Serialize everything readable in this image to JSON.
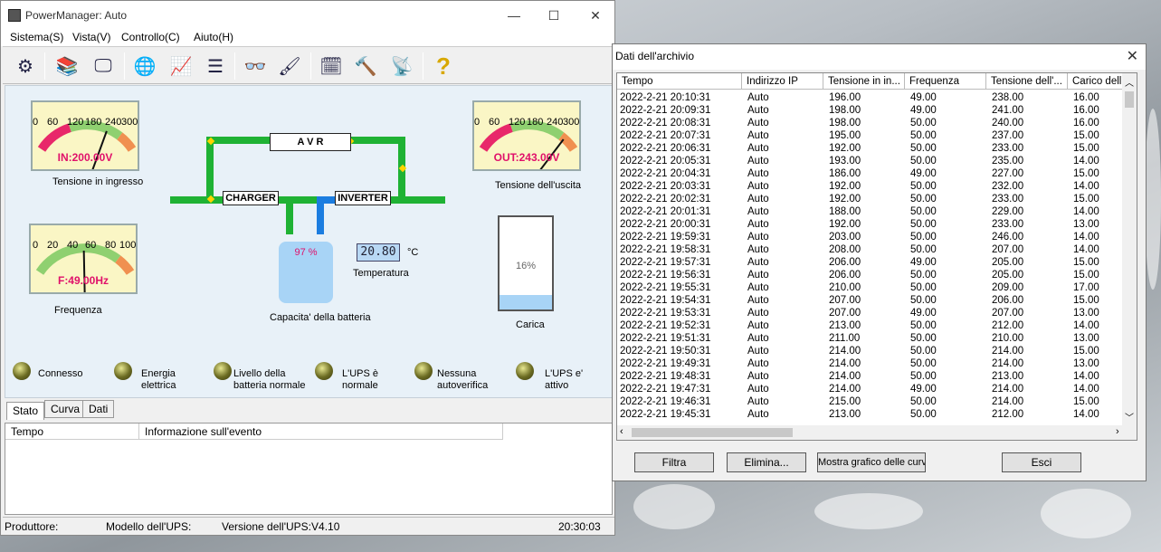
{
  "window": {
    "title": "PowerManager: Auto",
    "minimize": "—",
    "maximize": "☐",
    "close": "✕"
  },
  "menu": [
    "Sistema(S)",
    "Vista(V)",
    "Controllo(C)",
    "Aiuto(H)"
  ],
  "toolbar_icons": [
    "settings-tools-icon",
    "books-icon",
    "monitor-pen-icon",
    "globe-icon",
    "chart-icon",
    "list-icon",
    "glasses-icon",
    "brush-icon",
    "schedule-icon",
    "tools-icon",
    "signal-icon",
    "help-icon"
  ],
  "gauges": {
    "input": {
      "ticks": [
        "0",
        "60",
        "120",
        "180",
        "240",
        "300"
      ],
      "value_text": "IN:200.00V",
      "label": "Tensione in ingresso",
      "value": 200,
      "max": 300
    },
    "output": {
      "ticks": [
        "0",
        "60",
        "120",
        "180",
        "240",
        "300"
      ],
      "value_text": "OUT:243.00V",
      "label": "Tensione dell'uscita",
      "value": 243,
      "max": 300
    },
    "frequency": {
      "ticks": [
        "0",
        "20",
        "40",
        "60",
        "80",
        "100"
      ],
      "value_text": "F:49.00Hz",
      "label": "Frequenza",
      "value": 49,
      "max": 100
    }
  },
  "diagram": {
    "avr": "A V R",
    "charger": "CHARGER",
    "inverter": "INVERTER"
  },
  "battery": {
    "percent_text": "97 %",
    "label": "Capacita' della batteria",
    "level": 0.97
  },
  "temperature": {
    "value": "20.80",
    "unit": "°C",
    "label": "Temperatura"
  },
  "load": {
    "percent_text": "16%",
    "label": "Carica",
    "level": 0.16
  },
  "leds": [
    {
      "label1": "Connesso",
      "label2": ""
    },
    {
      "label1": "Energia",
      "label2": "elettrica"
    },
    {
      "label1": "Livello della",
      "label2": "batteria normale"
    },
    {
      "label1": "L'UPS è",
      "label2": "normale"
    },
    {
      "label1": "Nessuna",
      "label2": "autoverifica"
    },
    {
      "label1": "L'UPS e'",
      "label2": "attivo"
    }
  ],
  "tabs": [
    "Stato",
    "Curva",
    "Dati"
  ],
  "event_table": {
    "col1": "Tempo",
    "col2": "Informazione sull'evento"
  },
  "status": {
    "producer": "Produttore:",
    "model": "Modello dell'UPS:",
    "version": "Versione dell'UPS:V4.10",
    "time": "20:30:03"
  },
  "archive": {
    "title": "Dati dell'archivio",
    "headers": [
      "Tempo",
      "Indirizzo IP",
      "Tensione in in...",
      "Frequenza",
      "Tensione dell'...",
      "Carico dell'u"
    ],
    "rows": [
      [
        "2022-2-21 20:10:31",
        "Auto",
        "196.00",
        "49.00",
        "238.00",
        "16.00"
      ],
      [
        "2022-2-21 20:09:31",
        "Auto",
        "198.00",
        "49.00",
        "241.00",
        "16.00"
      ],
      [
        "2022-2-21 20:08:31",
        "Auto",
        "198.00",
        "50.00",
        "240.00",
        "16.00"
      ],
      [
        "2022-2-21 20:07:31",
        "Auto",
        "195.00",
        "50.00",
        "237.00",
        "15.00"
      ],
      [
        "2022-2-21 20:06:31",
        "Auto",
        "192.00",
        "50.00",
        "233.00",
        "15.00"
      ],
      [
        "2022-2-21 20:05:31",
        "Auto",
        "193.00",
        "50.00",
        "235.00",
        "14.00"
      ],
      [
        "2022-2-21 20:04:31",
        "Auto",
        "186.00",
        "49.00",
        "227.00",
        "15.00"
      ],
      [
        "2022-2-21 20:03:31",
        "Auto",
        "192.00",
        "50.00",
        "232.00",
        "14.00"
      ],
      [
        "2022-2-21 20:02:31",
        "Auto",
        "192.00",
        "50.00",
        "233.00",
        "15.00"
      ],
      [
        "2022-2-21 20:01:31",
        "Auto",
        "188.00",
        "50.00",
        "229.00",
        "14.00"
      ],
      [
        "2022-2-21 20:00:31",
        "Auto",
        "192.00",
        "50.00",
        "233.00",
        "13.00"
      ],
      [
        "2022-2-21 19:59:31",
        "Auto",
        "203.00",
        "50.00",
        "246.00",
        "14.00"
      ],
      [
        "2022-2-21 19:58:31",
        "Auto",
        "208.00",
        "50.00",
        "207.00",
        "14.00"
      ],
      [
        "2022-2-21 19:57:31",
        "Auto",
        "206.00",
        "49.00",
        "205.00",
        "15.00"
      ],
      [
        "2022-2-21 19:56:31",
        "Auto",
        "206.00",
        "50.00",
        "205.00",
        "15.00"
      ],
      [
        "2022-2-21 19:55:31",
        "Auto",
        "210.00",
        "50.00",
        "209.00",
        "17.00"
      ],
      [
        "2022-2-21 19:54:31",
        "Auto",
        "207.00",
        "50.00",
        "206.00",
        "15.00"
      ],
      [
        "2022-2-21 19:53:31",
        "Auto",
        "207.00",
        "49.00",
        "207.00",
        "13.00"
      ],
      [
        "2022-2-21 19:52:31",
        "Auto",
        "213.00",
        "50.00",
        "212.00",
        "14.00"
      ],
      [
        "2022-2-21 19:51:31",
        "Auto",
        "211.00",
        "50.00",
        "210.00",
        "13.00"
      ],
      [
        "2022-2-21 19:50:31",
        "Auto",
        "214.00",
        "50.00",
        "214.00",
        "15.00"
      ],
      [
        "2022-2-21 19:49:31",
        "Auto",
        "214.00",
        "50.00",
        "214.00",
        "13.00"
      ],
      [
        "2022-2-21 19:48:31",
        "Auto",
        "214.00",
        "50.00",
        "213.00",
        "14.00"
      ],
      [
        "2022-2-21 19:47:31",
        "Auto",
        "214.00",
        "49.00",
        "214.00",
        "14.00"
      ],
      [
        "2022-2-21 19:46:31",
        "Auto",
        "215.00",
        "50.00",
        "214.00",
        "15.00"
      ],
      [
        "2022-2-21 19:45:31",
        "Auto",
        "213.00",
        "50.00",
        "212.00",
        "14.00"
      ]
    ],
    "buttons": {
      "filter": "Filtra",
      "delete": "Elimina...",
      "chart": "Mostra grafico delle curve",
      "exit": "Esci"
    }
  }
}
